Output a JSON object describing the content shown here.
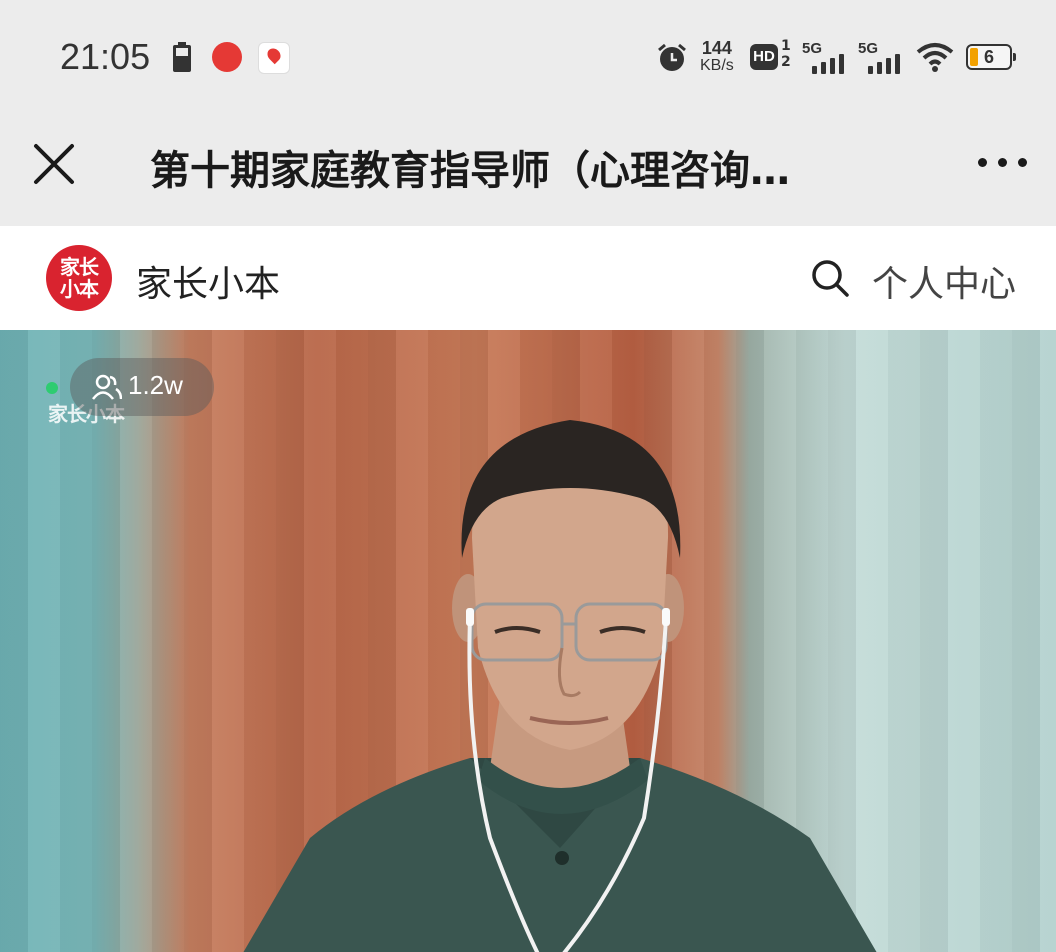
{
  "status_bar": {
    "time": "21:05",
    "speed_value": "144",
    "speed_unit": "KB/s",
    "hd_label": "HD",
    "hd_sub_top": "1",
    "hd_sub_bottom": "2",
    "sim1_label": "5G",
    "sim2_label": "5G",
    "battery_level": "6",
    "icons": [
      "battery-icon",
      "app-notification-icon",
      "maps-notification-icon",
      "alarm-icon",
      "hd-voice-icon",
      "signal-icon",
      "wifi-icon"
    ]
  },
  "title_bar": {
    "title": "第十期家庭教育指导师（心理咨询…",
    "close_icon": "close-icon",
    "more_icon": "more-icon"
  },
  "header": {
    "logo_line1": "家长",
    "logo_line2": "小本",
    "brand_name": "家长小本",
    "profile_label": "个人中心",
    "search_icon": "search-icon"
  },
  "video": {
    "viewer_count": "1.2w",
    "watermark": "家长小本",
    "live_indicator_color": "#2ecc71"
  },
  "colors": {
    "brand_red": "#d9232f",
    "battery_accent": "#f2a100"
  }
}
